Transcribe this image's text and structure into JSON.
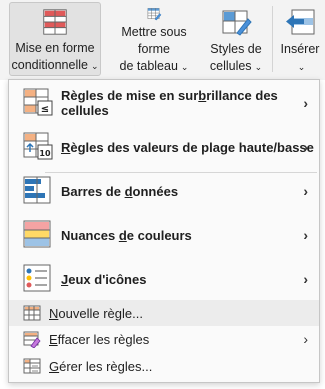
{
  "ribbon": {
    "conditional_formatting": {
      "line1": "Mise en forme",
      "line2": "conditionnelle",
      "caret": "⌄"
    },
    "format_as_table": {
      "line1": "Mettre sous forme",
      "line2": "de tableau",
      "caret": "⌄"
    },
    "cell_styles": {
      "line1": "Styles de",
      "line2": "cellules",
      "caret": "⌄"
    },
    "insert": {
      "line1": "Insérer",
      "caret": "⌄"
    }
  },
  "menu": {
    "items": [
      {
        "pre": "Règles de mise en sur",
        "u": "b",
        "post": "rillance des cellules",
        "chevron": "›"
      },
      {
        "pre": "",
        "u": "R",
        "post": "ègles des valeurs de plage haute/basse",
        "chevron": "›"
      },
      {
        "pre": "Barres de ",
        "u": "d",
        "post": "onnées",
        "chevron": "›"
      },
      {
        "pre": "Nuances ",
        "u": "d",
        "post": "e couleurs",
        "chevron": "›"
      },
      {
        "pre": "",
        "u": "J",
        "post": "eux d'icônes",
        "chevron": "›"
      },
      {
        "pre": "",
        "u": "N",
        "post": "ouvelle règle...",
        "chevron": ""
      },
      {
        "pre": "",
        "u": "E",
        "post": "ffacer les règles",
        "chevron": "›"
      },
      {
        "pre": "",
        "u": "G",
        "post": "érer les règles...",
        "chevron": ""
      }
    ]
  },
  "colors": {
    "accent_blue": "#2e75b6",
    "red": "#e05a5a",
    "yellow": "#ffd966"
  }
}
